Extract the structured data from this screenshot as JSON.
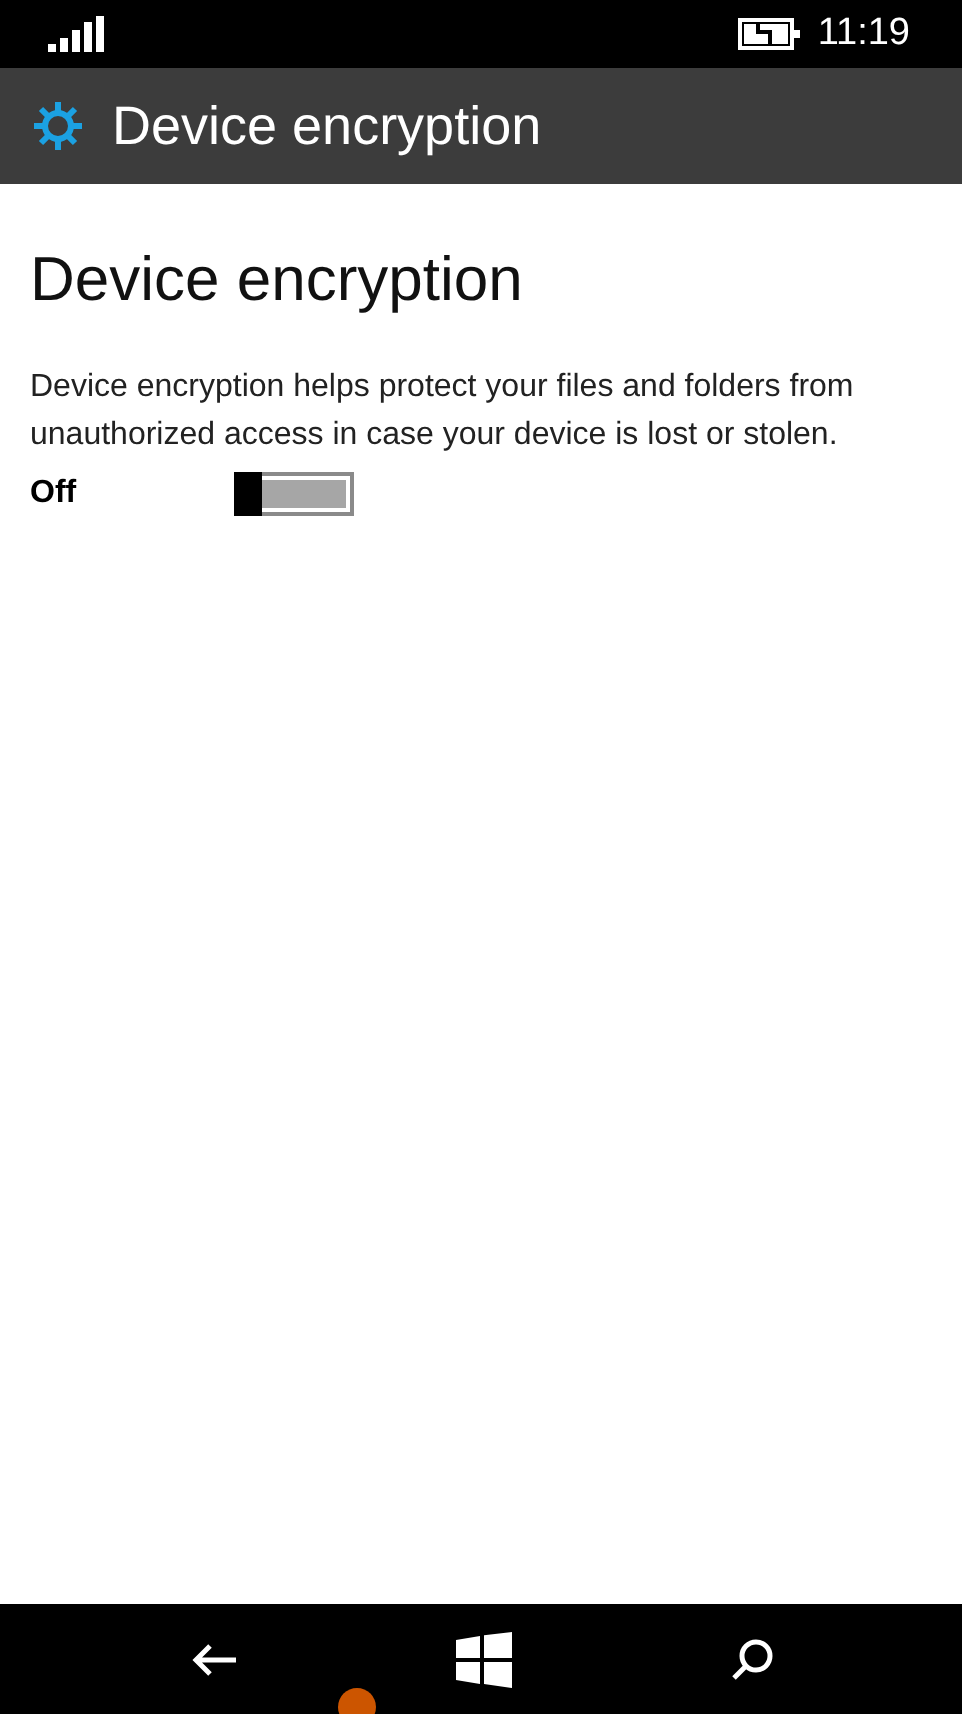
{
  "status_bar": {
    "time": "11:19"
  },
  "header": {
    "title": "Device encryption"
  },
  "page": {
    "heading": "Device encryption",
    "description": "Device encryption helps protect your files and folders from unauthorized access in case your device is lost or stolen.",
    "toggle": {
      "label": "Off",
      "on": false
    }
  },
  "nav_bar": {
    "touch_indicator": true
  }
}
